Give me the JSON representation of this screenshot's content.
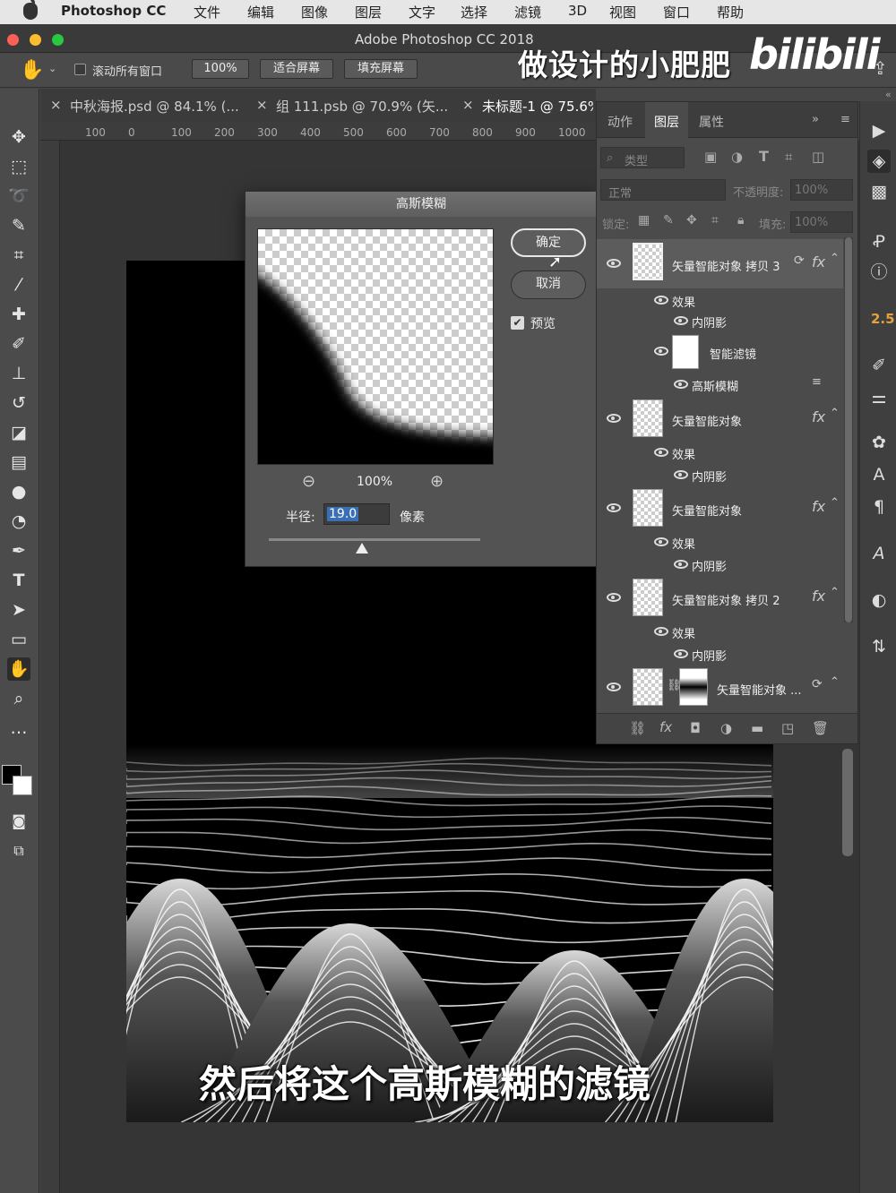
{
  "menubar": {
    "app": "Photoshop CC",
    "items": [
      "文件",
      "编辑",
      "图像",
      "图层",
      "文字",
      "选择",
      "滤镜",
      "3D",
      "视图",
      "窗口",
      "帮助"
    ]
  },
  "window": {
    "title": "Adobe Photoshop CC 2018"
  },
  "watermark": {
    "text": "做设计的小肥肥",
    "logo": "bilibili"
  },
  "options": {
    "scroll_all_label": "滚动所有窗口",
    "zoom": "100%",
    "fit_screen": "适合屏幕",
    "fill_screen": "填充屏幕"
  },
  "tabs": [
    {
      "close": "×",
      "label": "中秋海报.psd @ 84.1% (..."
    },
    {
      "close": "×",
      "label": "组 111.psb @ 70.9% (矢..."
    },
    {
      "close": "×",
      "label": "未标题-1 @ 75.6%"
    }
  ],
  "ruler": {
    "h": [
      "100",
      "0",
      "100",
      "200",
      "300",
      "400",
      "500",
      "600",
      "700",
      "800",
      "900",
      "1000"
    ]
  },
  "dialog": {
    "title": "高斯模糊",
    "ok": "确定",
    "cancel": "取消",
    "preview_label": "预览",
    "zoom_level": "100%",
    "radius_label": "半径:",
    "radius_value": "19.0",
    "unit": "像素",
    "slider_level": 0.44
  },
  "panel": {
    "tabs": [
      "动作",
      "图层",
      "属性"
    ],
    "filter_kind": "类型",
    "blend_mode": "正常",
    "opacity_label": "不透明度:",
    "opacity_value": "100%",
    "lock_label": "锁定:",
    "fill_label": "填充:",
    "fill_value": "100%",
    "layers": [
      {
        "name": "矢量智能对象 拷贝 3",
        "fx": "fx",
        "sub": [
          {
            "label": "效果"
          },
          {
            "label": "内阴影"
          },
          {
            "label": "智能滤镜"
          },
          {
            "label": "高斯模糊"
          }
        ]
      },
      {
        "name": "矢量智能对象",
        "fx": "fx",
        "sub": [
          {
            "label": "效果"
          },
          {
            "label": "内阴影"
          }
        ]
      },
      {
        "name": "矢量智能对象",
        "fx": "fx",
        "sub": [
          {
            "label": "效果"
          },
          {
            "label": "内阴影"
          }
        ]
      },
      {
        "name": "矢量智能对象 拷贝 2",
        "fx": "fx",
        "sub": [
          {
            "label": "效果"
          },
          {
            "label": "内阴影"
          }
        ]
      },
      {
        "name": "矢量智能对象 ..."
      }
    ]
  },
  "dock": {
    "value": "2.5"
  },
  "subtitle": "然后将这个高斯模糊的滤镜",
  "colors": {
    "menubar": "#e6e6e6",
    "panel": "#4b4b4b",
    "dialog": "#535353",
    "selection": "#3a6fb5"
  }
}
